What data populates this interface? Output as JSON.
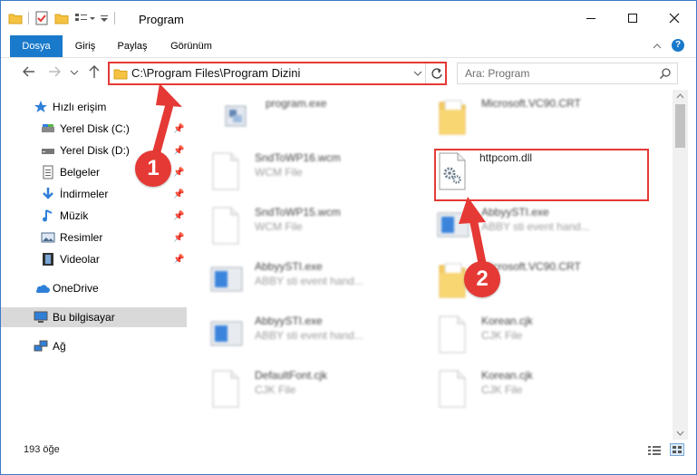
{
  "window": {
    "title": "Program"
  },
  "ribbon": {
    "tabs": [
      {
        "label": "Dosya",
        "active": true
      },
      {
        "label": "Giriş"
      },
      {
        "label": "Paylaş"
      },
      {
        "label": "Görünüm"
      }
    ]
  },
  "address": {
    "path": "C:\\Program Files\\Program Dizini"
  },
  "search": {
    "placeholder": "Ara: Program"
  },
  "sidebar": {
    "quick_access": "Hızlı erişim",
    "items": [
      {
        "label": "Yerel Disk (C:)",
        "icon": "drive-icon"
      },
      {
        "label": "Yerel Disk (D:)",
        "icon": "drive-icon"
      },
      {
        "label": "Belgeler",
        "icon": "documents-icon"
      },
      {
        "label": "İndirmeler",
        "icon": "downloads-icon"
      },
      {
        "label": "Müzik",
        "icon": "music-icon"
      },
      {
        "label": "Resimler",
        "icon": "pictures-icon"
      },
      {
        "label": "Videolar",
        "icon": "videos-icon"
      }
    ],
    "onedrive": "OneDrive",
    "this_pc": "Bu bilgisayar",
    "network": "Ağ"
  },
  "files": [
    {
      "name": "program.exe",
      "type": "",
      "icon": "exe-icon"
    },
    {
      "name": "Microsoft.VC90.CRT",
      "type": "",
      "icon": "folder-icon"
    },
    {
      "name": "SndToWP16.wcm",
      "type": "WCM File",
      "icon": "file-icon"
    },
    {
      "name": "httpcom.dll",
      "type": "",
      "icon": "dll-icon"
    },
    {
      "name": "SndToWP15.wcm",
      "type": "WCM File",
      "icon": "file-icon"
    },
    {
      "name": "AbbyySTI.exe",
      "type": "ABBY sti event hand...",
      "icon": "app-icon"
    },
    {
      "name": "AbbyySTI.exe",
      "type": "ABBY sti event hand...",
      "icon": "app-icon"
    },
    {
      "name": "Microsoft.VC90.CRT",
      "type": "",
      "icon": "folder-icon"
    },
    {
      "name": "AbbyySTI.exe",
      "type": "ABBY sti event hand...",
      "icon": "app-icon"
    },
    {
      "name": "Korean.cjk",
      "type": "CJK File",
      "icon": "file-icon"
    },
    {
      "name": "DefaultFont.cjk",
      "type": "CJK File",
      "icon": "file-icon"
    },
    {
      "name": "Korean.cjk",
      "type": "CJK File",
      "icon": "file-icon"
    }
  ],
  "status": {
    "count": "193 öğe"
  },
  "callouts": [
    "1",
    "2"
  ],
  "colors": {
    "accent": "#1979ca",
    "highlight": "#e53935"
  }
}
